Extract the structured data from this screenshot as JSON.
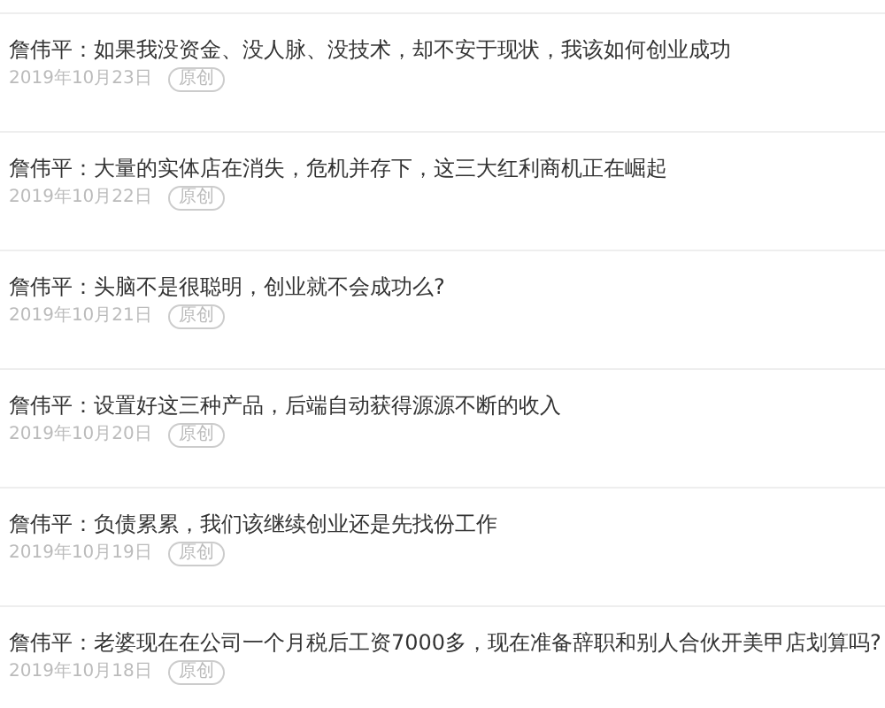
{
  "articles": [
    {
      "title": "詹伟平：如果我没资金、没人脉、没技术，却不安于现状，我该如何创业成功",
      "date": "2019年10月23日",
      "tag": "原创"
    },
    {
      "title": "詹伟平：大量的实体店在消失，危机并存下，这三大红利商机正在崛起",
      "date": "2019年10月22日",
      "tag": "原创"
    },
    {
      "title": "詹伟平：头脑不是很聪明，创业就不会成功么?",
      "date": "2019年10月21日",
      "tag": "原创"
    },
    {
      "title": "詹伟平：设置好这三种产品，后端自动获得源源不断的收入",
      "date": "2019年10月20日",
      "tag": "原创"
    },
    {
      "title": "詹伟平：负债累累，我们该继续创业还是先找份工作",
      "date": "2019年10月19日",
      "tag": "原创"
    },
    {
      "title": "詹伟平：老婆现在在公司一个月税后工资7000多，现在准备辞职和别人合伙开美甲店划算吗?",
      "date": "2019年10月18日",
      "tag": "原创"
    }
  ]
}
